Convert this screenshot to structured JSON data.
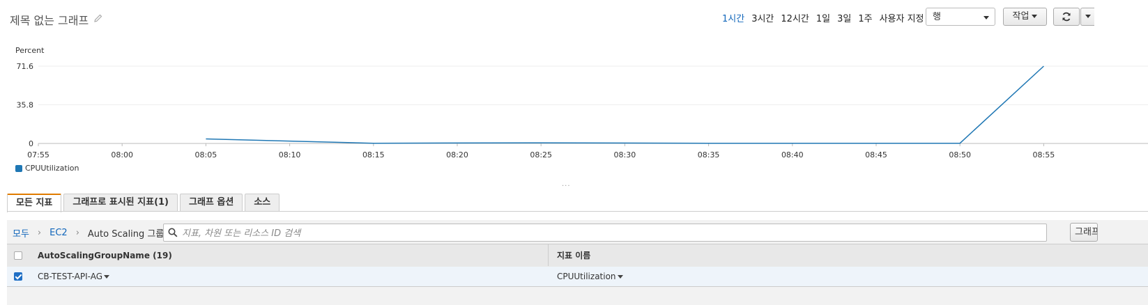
{
  "header": {
    "title": "제목 없는 그래프",
    "time_ranges": [
      {
        "label": "1시간",
        "active": true
      },
      {
        "label": "3시간",
        "active": false
      },
      {
        "label": "12시간",
        "active": false
      },
      {
        "label": "1일",
        "active": false
      },
      {
        "label": "3일",
        "active": false
      },
      {
        "label": "1주",
        "active": false
      }
    ],
    "custom_range_label": "사용자 지정",
    "chart_type_select": "행",
    "actions_label": "작업"
  },
  "chart_data": {
    "type": "line",
    "ylabel": "Percent",
    "ylim": [
      0,
      71.6
    ],
    "yticks": [
      "71.6",
      "35.8",
      "0"
    ],
    "x_ticks": [
      "07:55",
      "08:00",
      "08:05",
      "08:10",
      "08:15",
      "08:20",
      "08:25",
      "08:30",
      "08:35",
      "08:40",
      "08:45",
      "08:50",
      "08:55"
    ],
    "series": [
      {
        "name": "CPUUtilization",
        "color": "#1f77b4",
        "points": [
          {
            "x": "08:05",
            "y": 4.2
          },
          {
            "x": "08:15",
            "y": 0.2
          },
          {
            "x": "08:25",
            "y": 0.6
          },
          {
            "x": "08:35",
            "y": 0.2
          },
          {
            "x": "08:45",
            "y": 0.2
          },
          {
            "x": "08:50",
            "y": 0.2
          },
          {
            "x": "08:55",
            "y": 71.6
          }
        ]
      }
    ],
    "grid": true,
    "legend": "bottom-left"
  },
  "tabs": [
    {
      "label": "모든 지표",
      "active": true
    },
    {
      "label": "그래프로 표시된 지표(1)",
      "active": false
    },
    {
      "label": "그래프 옵션",
      "active": false
    },
    {
      "label": "소스",
      "active": false
    }
  ],
  "breadcrumb": {
    "items": [
      "모두",
      "EC2",
      "Auto Scaling 그룹별"
    ]
  },
  "search": {
    "placeholder": "지표, 차원 또는 리소스 ID 검색"
  },
  "graph_button_label": "그래프",
  "table": {
    "columns": [
      "AutoScalingGroupName (19)",
      "지표 이름"
    ],
    "rows": [
      {
        "checked": true,
        "group": "CB-TEST-API-AG",
        "metric": "CPUUtilization"
      }
    ]
  }
}
